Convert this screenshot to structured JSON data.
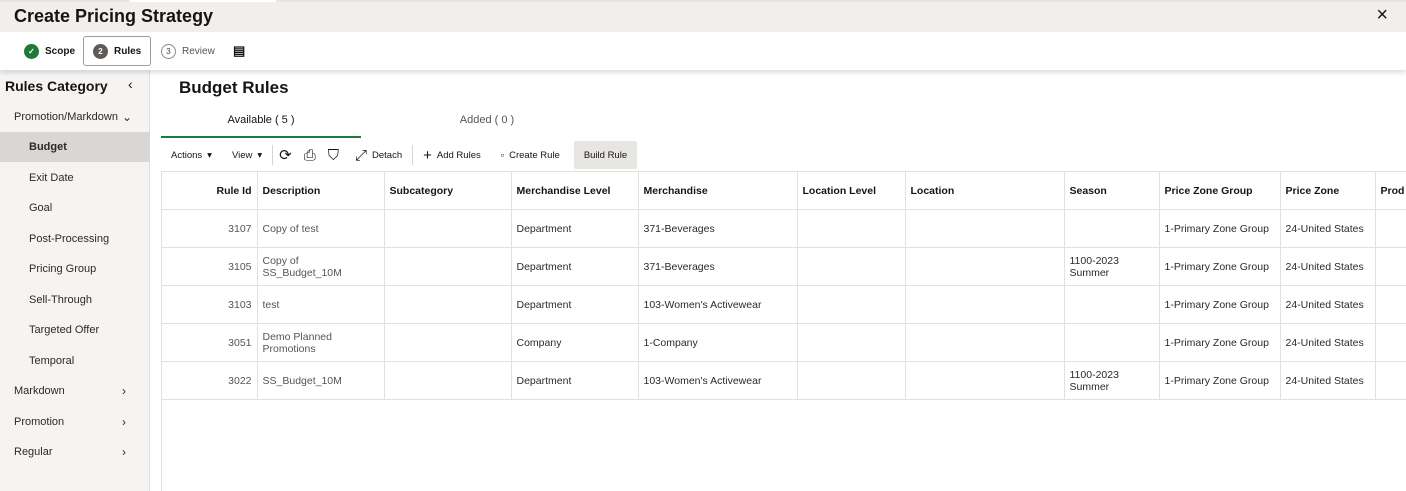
{
  "header": {
    "title": "Create Pricing Strategy",
    "close_icon": "×"
  },
  "train": {
    "steps": [
      {
        "num": "✓",
        "label": "Scope"
      },
      {
        "num": "2",
        "label": "Rules"
      },
      {
        "num": "3",
        "label": "Review"
      }
    ],
    "panel_icon": "▤"
  },
  "sidebar": {
    "title": "Rules Category",
    "collapse_icon": "‹",
    "items": [
      {
        "label": "Promotion/Markdown",
        "chev": "⌄"
      },
      {
        "label": "Budget"
      },
      {
        "label": "Exit Date"
      },
      {
        "label": "Goal"
      },
      {
        "label": "Post-Processing"
      },
      {
        "label": "Pricing Group"
      },
      {
        "label": "Sell-Through"
      },
      {
        "label": "Targeted Offer"
      },
      {
        "label": "Temporal"
      },
      {
        "label": "Markdown",
        "chev": "›"
      },
      {
        "label": "Promotion",
        "chev": "›"
      },
      {
        "label": "Regular",
        "chev": "›"
      }
    ]
  },
  "main": {
    "title": "Budget Rules",
    "tabs": [
      {
        "label": "Available ( 5 )"
      },
      {
        "label": "Added ( 0 )"
      }
    ]
  },
  "toolbar": {
    "actions": "Actions",
    "view": "View",
    "caret": "▾",
    "refresh_icon": "⟳",
    "export_icon": "⎙",
    "filter_icon": "⛉",
    "detach_icon": "⤢",
    "detach": "Detach",
    "add_icon": "+",
    "add_rules": "Add Rules",
    "create_icon": "▫",
    "create_rule": "Create Rule",
    "build_rule": "Build Rule"
  },
  "table": {
    "columns": [
      "Rule Id",
      "Description",
      "Subcategory",
      "Merchandise Level",
      "Merchandise",
      "Location Level",
      "Location",
      "Season",
      "Price Zone Group",
      "Price Zone",
      "Prod"
    ],
    "rows": [
      [
        "3107",
        "Copy of test",
        "",
        "Department",
        "371-Beverages",
        "",
        "",
        "",
        "1-Primary Zone Group",
        "24-United States",
        ""
      ],
      [
        "3105",
        "Copy of SS_Budget_10M",
        "",
        "Department",
        "371-Beverages",
        "",
        "",
        "1100-2023 Summer",
        "1-Primary Zone Group",
        "24-United States",
        ""
      ],
      [
        "3103",
        "test",
        "",
        "Department",
        "103-Women's Activewear",
        "",
        "",
        "",
        "1-Primary Zone Group",
        "24-United States",
        ""
      ],
      [
        "3051",
        "Demo Planned Promotions",
        "",
        "Company",
        "1-Company",
        "",
        "",
        "",
        "1-Primary Zone Group",
        "24-United States",
        ""
      ],
      [
        "3022",
        "SS_Budget_10M",
        "",
        "Department",
        "103-Women's Activewear",
        "",
        "",
        "1100-2023 Summer",
        "1-Primary Zone Group",
        "24-United States",
        ""
      ]
    ]
  }
}
